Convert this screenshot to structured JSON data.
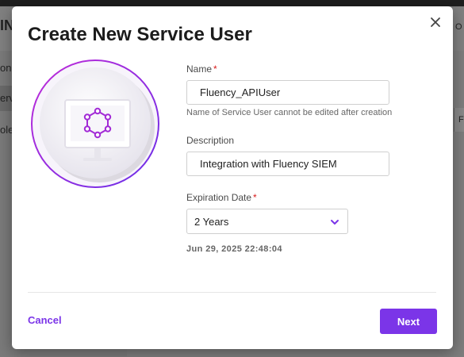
{
  "background": {
    "header_fragment": "IN",
    "header_right_fragment": "O",
    "sidebar_items": [
      "on",
      "erv",
      "ole"
    ],
    "right_box_label": "F"
  },
  "modal": {
    "title": "Create New Service User",
    "close_icon": "close-icon",
    "illustration_icon": "monitor-hexagon-icon",
    "form": {
      "name": {
        "label": "Name",
        "required_mark": "*",
        "value": "Fluency_APIUser",
        "hint": "Name of Service User cannot be edited after creation"
      },
      "description": {
        "label": "Description",
        "value": "Integration with Fluency SIEM"
      },
      "expiration": {
        "label": "Expiration Date",
        "required_mark": "*",
        "selected": "2 Years",
        "computed_date": "Jun 29, 2025 22:48:04"
      }
    },
    "footer": {
      "cancel_label": "Cancel",
      "next_label": "Next"
    }
  },
  "colors": {
    "accent": "#7b35e8",
    "required": "#d81b1b",
    "overlay": "#7d7d7d"
  }
}
